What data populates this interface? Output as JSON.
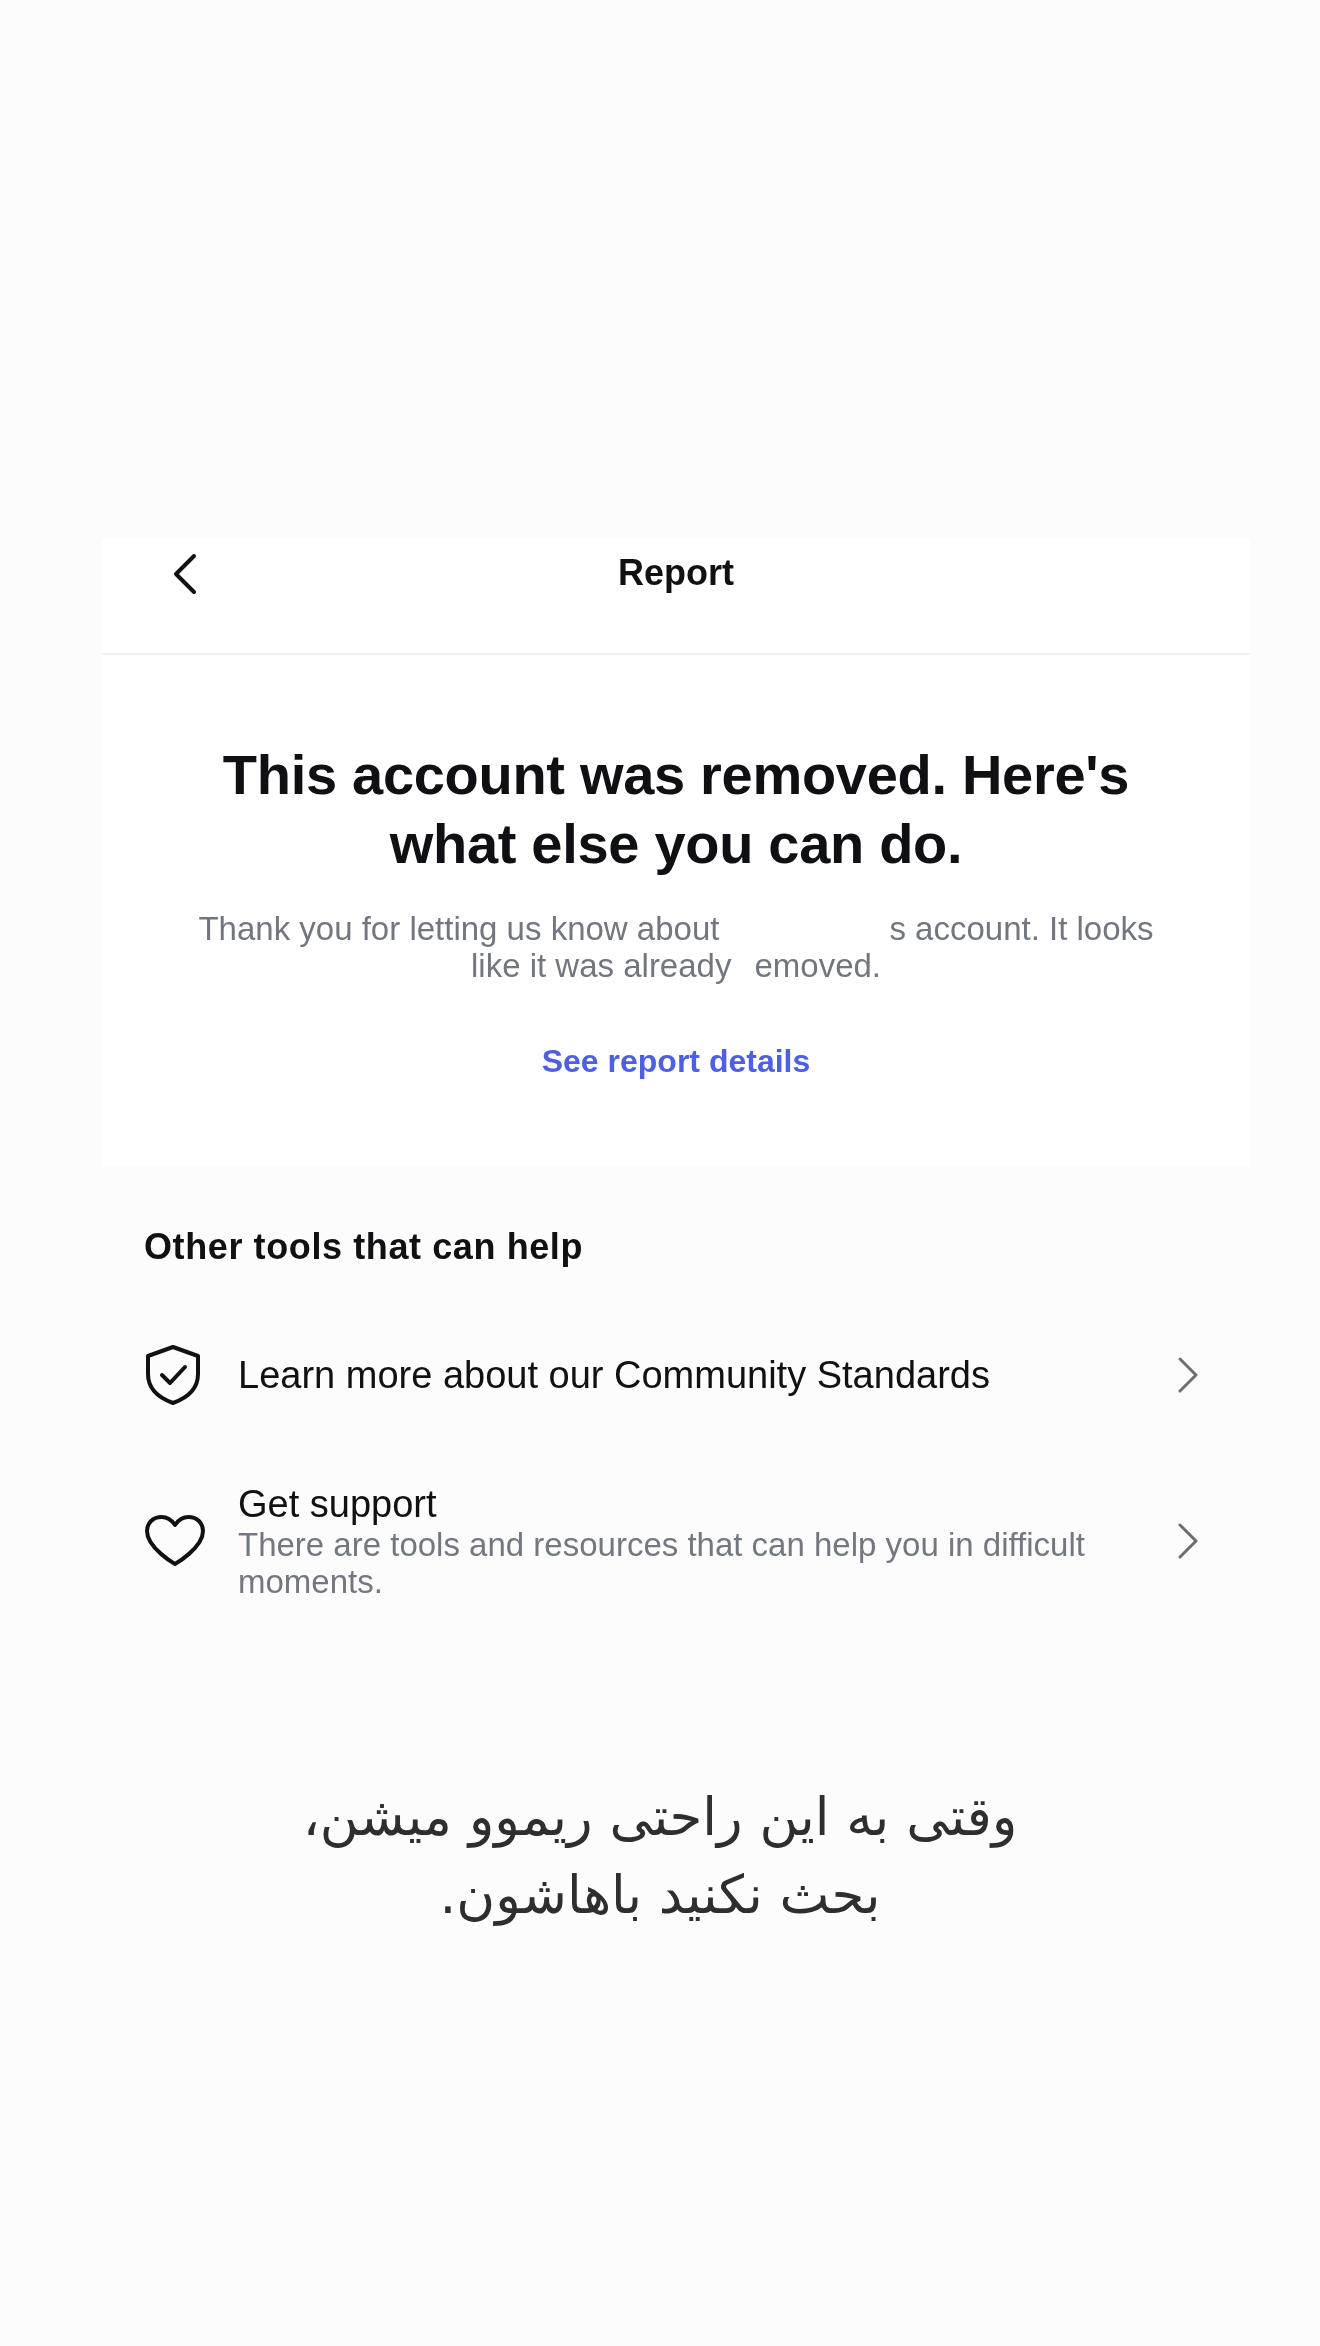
{
  "header": {
    "title": "Report"
  },
  "notice": {
    "heading": "This account was removed. Here's what else you can do.",
    "description_lines": [
      [
        "Thank you for letting us know about",
        "s account. It looks"
      ],
      [
        "like it was already",
        "emoved."
      ]
    ],
    "link": "See report details"
  },
  "tools": {
    "title": "Other tools that can help",
    "items": [
      {
        "title": "Learn more about our Community Standards"
      },
      {
        "title": "Get support",
        "subtitle": "There are tools and resources that can help you in difficult moments."
      }
    ]
  },
  "caption": "وقتی به این راحتی ریموو میشن، بحث نکنید باهاشون."
}
